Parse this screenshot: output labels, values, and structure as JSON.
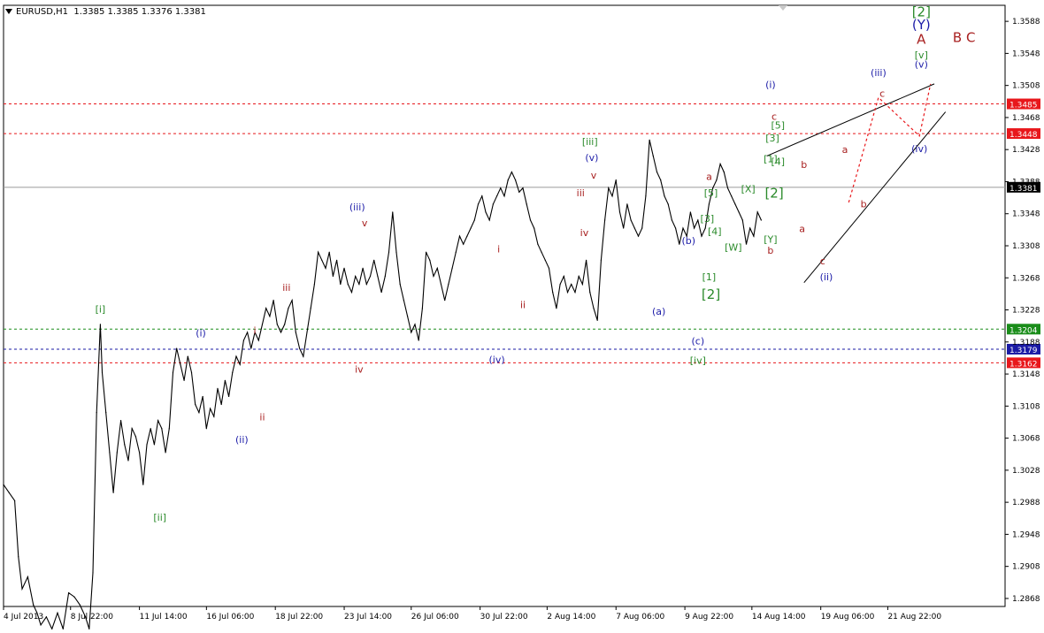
{
  "header": {
    "symbol": "EURUSD,H1",
    "ohlc": "1.3385 1.3385 1.3376 1.3381"
  },
  "colors": {
    "background": "#ffffff",
    "price": "#000000",
    "red_level": "#e8171b",
    "green_level": "#1a8d1a",
    "blue_level": "#1a1aa5",
    "grey_level": "#9a9a9a",
    "wave_blue": "#1d1da8",
    "wave_green": "#2a8a2a",
    "wave_red": "#a82020"
  },
  "chart_data": {
    "type": "line",
    "title": "",
    "xlabel": "",
    "ylabel": "",
    "ylim": [
      1.2858,
      1.3608
    ],
    "y_ticks": [
      "1.2868",
      "1.2908",
      "1.2948",
      "1.2988",
      "1.3028",
      "1.3068",
      "1.3108",
      "1.3148",
      "1.3188",
      "1.3228",
      "1.3268",
      "1.3308",
      "1.3348",
      "1.3388",
      "1.3428",
      "1.3468",
      "1.3508",
      "1.3548",
      "1.3588"
    ],
    "x_ticks": [
      "4 Jul 2013",
      "8 Jul 22:00",
      "11 Jul 14:00",
      "16 Jul 06:00",
      "18 Jul 22:00",
      "23 Jul 14:00",
      "26 Jul 06:00",
      "30 Jul 22:00",
      "2 Aug 14:00",
      "7 Aug 06:00",
      "9 Aug 22:00",
      "14 Aug 14:00",
      "19 Aug 06:00",
      "21 Aug 22:00"
    ],
    "x_tick_index": [
      0,
      36,
      73,
      109,
      146,
      183,
      219,
      256,
      292,
      329,
      366,
      402,
      439,
      475
    ],
    "index_span": [
      0,
      538
    ],
    "grid": false,
    "series": [
      {
        "values": [
          [
            0,
            1.301
          ],
          [
            3,
            1.3
          ],
          [
            6,
            1.299
          ],
          [
            8,
            1.292
          ],
          [
            10,
            1.288
          ],
          [
            13,
            1.2895
          ],
          [
            16,
            1.286
          ],
          [
            18,
            1.285
          ],
          [
            20,
            1.2835
          ],
          [
            23,
            1.2845
          ],
          [
            26,
            1.283
          ],
          [
            29,
            1.285
          ],
          [
            32,
            1.283
          ],
          [
            35,
            1.2875
          ],
          [
            38,
            1.287
          ],
          [
            41,
            1.286
          ],
          [
            44,
            1.2845
          ],
          [
            46,
            1.283
          ],
          [
            48,
            1.29
          ],
          [
            50,
            1.31
          ],
          [
            52,
            1.321
          ],
          [
            53,
            1.315
          ],
          [
            55,
            1.31
          ],
          [
            57,
            1.305
          ],
          [
            59,
            1.3
          ],
          [
            61,
            1.305
          ],
          [
            63,
            1.309
          ],
          [
            65,
            1.306
          ],
          [
            67,
            1.304
          ],
          [
            69,
            1.308
          ],
          [
            71,
            1.307
          ],
          [
            73,
            1.305
          ],
          [
            75,
            1.301
          ],
          [
            77,
            1.306
          ],
          [
            79,
            1.308
          ],
          [
            81,
            1.306
          ],
          [
            83,
            1.309
          ],
          [
            85,
            1.308
          ],
          [
            87,
            1.305
          ],
          [
            89,
            1.308
          ],
          [
            91,
            1.315
          ],
          [
            93,
            1.318
          ],
          [
            95,
            1.316
          ],
          [
            97,
            1.314
          ],
          [
            99,
            1.317
          ],
          [
            101,
            1.315
          ],
          [
            103,
            1.311
          ],
          [
            105,
            1.31
          ],
          [
            107,
            1.312
          ],
          [
            109,
            1.308
          ],
          [
            111,
            1.3105
          ],
          [
            113,
            1.3095
          ],
          [
            115,
            1.313
          ],
          [
            117,
            1.311
          ],
          [
            119,
            1.314
          ],
          [
            121,
            1.312
          ],
          [
            123,
            1.315
          ],
          [
            125,
            1.317
          ],
          [
            127,
            1.316
          ],
          [
            129,
            1.319
          ],
          [
            131,
            1.32
          ],
          [
            133,
            1.318
          ],
          [
            135,
            1.32
          ],
          [
            137,
            1.319
          ],
          [
            139,
            1.321
          ],
          [
            141,
            1.323
          ],
          [
            143,
            1.322
          ],
          [
            145,
            1.324
          ],
          [
            147,
            1.321
          ],
          [
            149,
            1.32
          ],
          [
            151,
            1.321
          ],
          [
            153,
            1.323
          ],
          [
            155,
            1.324
          ],
          [
            157,
            1.32
          ],
          [
            159,
            1.318
          ],
          [
            161,
            1.317
          ],
          [
            163,
            1.32
          ],
          [
            165,
            1.323
          ],
          [
            167,
            1.326
          ],
          [
            169,
            1.33
          ],
          [
            171,
            1.329
          ],
          [
            173,
            1.328
          ],
          [
            175,
            1.33
          ],
          [
            177,
            1.327
          ],
          [
            179,
            1.329
          ],
          [
            181,
            1.326
          ],
          [
            183,
            1.328
          ],
          [
            185,
            1.326
          ],
          [
            187,
            1.325
          ],
          [
            189,
            1.327
          ],
          [
            191,
            1.326
          ],
          [
            193,
            1.328
          ],
          [
            195,
            1.326
          ],
          [
            197,
            1.327
          ],
          [
            199,
            1.329
          ],
          [
            201,
            1.327
          ],
          [
            203,
            1.325
          ],
          [
            205,
            1.327
          ],
          [
            207,
            1.33
          ],
          [
            209,
            1.335
          ],
          [
            211,
            1.33
          ],
          [
            213,
            1.326
          ],
          [
            215,
            1.324
          ],
          [
            217,
            1.322
          ],
          [
            219,
            1.32
          ],
          [
            221,
            1.321
          ],
          [
            223,
            1.319
          ],
          [
            225,
            1.323
          ],
          [
            227,
            1.33
          ],
          [
            229,
            1.329
          ],
          [
            231,
            1.327
          ],
          [
            233,
            1.328
          ],
          [
            235,
            1.326
          ],
          [
            237,
            1.324
          ],
          [
            239,
            1.326
          ],
          [
            241,
            1.328
          ],
          [
            243,
            1.33
          ],
          [
            245,
            1.332
          ],
          [
            247,
            1.331
          ],
          [
            249,
            1.332
          ],
          [
            251,
            1.333
          ],
          [
            253,
            1.334
          ],
          [
            255,
            1.336
          ],
          [
            257,
            1.337
          ],
          [
            259,
            1.335
          ],
          [
            261,
            1.334
          ],
          [
            263,
            1.336
          ],
          [
            265,
            1.337
          ],
          [
            267,
            1.338
          ],
          [
            269,
            1.337
          ],
          [
            271,
            1.339
          ],
          [
            273,
            1.34
          ],
          [
            275,
            1.339
          ],
          [
            277,
            1.3375
          ],
          [
            279,
            1.338
          ],
          [
            281,
            1.336
          ],
          [
            283,
            1.334
          ],
          [
            285,
            1.333
          ],
          [
            287,
            1.331
          ],
          [
            289,
            1.33
          ],
          [
            291,
            1.329
          ],
          [
            293,
            1.328
          ],
          [
            295,
            1.325
          ],
          [
            297,
            1.323
          ],
          [
            299,
            1.326
          ],
          [
            301,
            1.327
          ],
          [
            303,
            1.325
          ],
          [
            305,
            1.326
          ],
          [
            307,
            1.325
          ],
          [
            309,
            1.327
          ],
          [
            311,
            1.326
          ],
          [
            313,
            1.329
          ],
          [
            315,
            1.325
          ],
          [
            317,
            1.323
          ],
          [
            319,
            1.3215
          ],
          [
            321,
            1.329
          ],
          [
            323,
            1.334
          ],
          [
            325,
            1.338
          ],
          [
            327,
            1.337
          ],
          [
            329,
            1.339
          ],
          [
            331,
            1.335
          ],
          [
            333,
            1.333
          ],
          [
            335,
            1.336
          ],
          [
            337,
            1.334
          ],
          [
            339,
            1.333
          ],
          [
            341,
            1.332
          ],
          [
            343,
            1.333
          ],
          [
            345,
            1.337
          ],
          [
            347,
            1.344
          ],
          [
            349,
            1.342
          ],
          [
            351,
            1.34
          ],
          [
            353,
            1.339
          ],
          [
            355,
            1.337
          ],
          [
            357,
            1.336
          ],
          [
            359,
            1.334
          ],
          [
            361,
            1.333
          ],
          [
            363,
            1.331
          ],
          [
            365,
            1.333
          ],
          [
            367,
            1.332
          ],
          [
            369,
            1.335
          ],
          [
            371,
            1.333
          ],
          [
            373,
            1.334
          ],
          [
            375,
            1.332
          ],
          [
            377,
            1.333
          ],
          [
            379,
            1.336
          ],
          [
            381,
            1.338
          ],
          [
            383,
            1.339
          ],
          [
            385,
            1.341
          ],
          [
            387,
            1.34
          ],
          [
            389,
            1.338
          ],
          [
            391,
            1.337
          ],
          [
            393,
            1.336
          ],
          [
            395,
            1.335
          ],
          [
            397,
            1.334
          ],
          [
            399,
            1.331
          ],
          [
            401,
            1.333
          ],
          [
            403,
            1.332
          ],
          [
            405,
            1.335
          ],
          [
            407,
            1.334
          ]
        ]
      }
    ],
    "levels": [
      {
        "value": 1.3485,
        "label": "1.3485",
        "style": "red"
      },
      {
        "value": 1.3448,
        "label": "1.3448",
        "style": "red"
      },
      {
        "value": 1.3381,
        "label": "1.3381",
        "style": "grey"
      },
      {
        "value": 1.3204,
        "label": "1.3204",
        "style": "green"
      },
      {
        "value": 1.3179,
        "label": "1.3179",
        "style": "blue"
      },
      {
        "value": 1.3162,
        "label": "1.3162",
        "style": "red"
      }
    ],
    "annotations": [
      {
        "text": "[i]",
        "i": 52,
        "y": 1.3225,
        "color": "green"
      },
      {
        "text": "[ii]",
        "i": 84,
        "y": 1.2965,
        "color": "green"
      },
      {
        "text": "(i)",
        "i": 106,
        "y": 1.3195,
        "color": "blue"
      },
      {
        "text": "(ii)",
        "i": 128,
        "y": 1.3062,
        "color": "blue"
      },
      {
        "text": "(iii)",
        "i": 190,
        "y": 1.3352,
        "color": "blue"
      },
      {
        "text": "(iv)",
        "i": 265,
        "y": 1.3162,
        "color": "blue"
      },
      {
        "text": "[iii]",
        "i": 315,
        "y": 1.3434,
        "color": "green"
      },
      {
        "text": "(v)",
        "i": 316,
        "y": 1.3414,
        "color": "blue"
      },
      {
        "text": "(a)",
        "i": 352,
        "y": 1.3222,
        "color": "blue"
      },
      {
        "text": "(b)",
        "i": 368,
        "y": 1.331,
        "color": "blue"
      },
      {
        "text": "(c)",
        "i": 373,
        "y": 1.3185,
        "color": "blue"
      },
      {
        "text": "[iv]",
        "i": 373,
        "y": 1.3161,
        "color": "green"
      },
      {
        "text": "(i)",
        "i": 412,
        "y": 1.3505,
        "color": "blue"
      },
      {
        "text": "(ii)",
        "i": 442,
        "y": 1.3265,
        "color": "blue"
      },
      {
        "text": "(iii)",
        "i": 470,
        "y": 1.352,
        "color": "blue"
      },
      {
        "text": "(iv)",
        "i": 492,
        "y": 1.3425,
        "color": "blue"
      },
      {
        "text": "(v)",
        "i": 493,
        "y": 1.353,
        "color": "blue"
      },
      {
        "text": "[v]",
        "i": 493,
        "y": 1.3542,
        "color": "green"
      },
      {
        "text": "A",
        "i": 493,
        "y": 1.356,
        "color": "red"
      },
      {
        "text": "(Y)",
        "i": 493,
        "y": 1.3578,
        "color": "blue"
      },
      {
        "text": "[2]",
        "i": 493,
        "y": 1.3594,
        "color": "green"
      },
      {
        "text": "B C",
        "i": 516,
        "y": 1.3562,
        "color": "red"
      },
      {
        "text": "i",
        "i": 135,
        "y": 1.3198,
        "color": "red"
      },
      {
        "text": "ii",
        "i": 139,
        "y": 1.309,
        "color": "red"
      },
      {
        "text": "iii",
        "i": 152,
        "y": 1.3252,
        "color": "red"
      },
      {
        "text": "iv",
        "i": 191,
        "y": 1.315,
        "color": "red"
      },
      {
        "text": "v",
        "i": 194,
        "y": 1.3332,
        "color": "red"
      },
      {
        "text": "i",
        "i": 266,
        "y": 1.33,
        "color": "red"
      },
      {
        "text": "ii",
        "i": 279,
        "y": 1.323,
        "color": "red"
      },
      {
        "text": "iii",
        "i": 310,
        "y": 1.337,
        "color": "red"
      },
      {
        "text": "iv",
        "i": 312,
        "y": 1.332,
        "color": "red"
      },
      {
        "text": "v",
        "i": 317,
        "y": 1.3392,
        "color": "red"
      },
      {
        "text": "a",
        "i": 379,
        "y": 1.339,
        "color": "red"
      },
      {
        "text": "[5]",
        "i": 380,
        "y": 1.337,
        "color": "green"
      },
      {
        "text": "[3]",
        "i": 378,
        "y": 1.3338,
        "color": "green"
      },
      {
        "text": "[4]",
        "i": 382,
        "y": 1.3322,
        "color": "green"
      },
      {
        "text": "[W]",
        "i": 392,
        "y": 1.3302,
        "color": "green"
      },
      {
        "text": "[X]",
        "i": 400,
        "y": 1.3375,
        "color": "green"
      },
      {
        "text": "[Y]",
        "i": 412,
        "y": 1.3312,
        "color": "green"
      },
      {
        "text": "b",
        "i": 412,
        "y": 1.3298,
        "color": "red"
      },
      {
        "text": "[1]",
        "i": 379,
        "y": 1.3265,
        "color": "green"
      },
      {
        "text": "[2]",
        "i": 380,
        "y": 1.3242,
        "color": "green"
      },
      {
        "text": "c",
        "i": 414,
        "y": 1.3465,
        "color": "red"
      },
      {
        "text": "[5]",
        "i": 416,
        "y": 1.3454,
        "color": "green"
      },
      {
        "text": "[3]",
        "i": 413,
        "y": 1.3438,
        "color": "green"
      },
      {
        "text": "[1]",
        "i": 412,
        "y": 1.3412,
        "color": "green"
      },
      {
        "text": "[4]",
        "i": 416,
        "y": 1.3409,
        "color": "green"
      },
      {
        "text": "[2]",
        "i": 414,
        "y": 1.3368,
        "color": "green"
      },
      {
        "text": "b",
        "i": 430,
        "y": 1.3405,
        "color": "red"
      },
      {
        "text": "a",
        "i": 429,
        "y": 1.3325,
        "color": "red"
      },
      {
        "text": "c",
        "i": 440,
        "y": 1.3285,
        "color": "red"
      },
      {
        "text": "a",
        "i": 452,
        "y": 1.3424,
        "color": "red"
      },
      {
        "text": "b",
        "i": 462,
        "y": 1.3356,
        "color": "red"
      },
      {
        "text": "c",
        "i": 472,
        "y": 1.3494,
        "color": "red"
      }
    ]
  }
}
